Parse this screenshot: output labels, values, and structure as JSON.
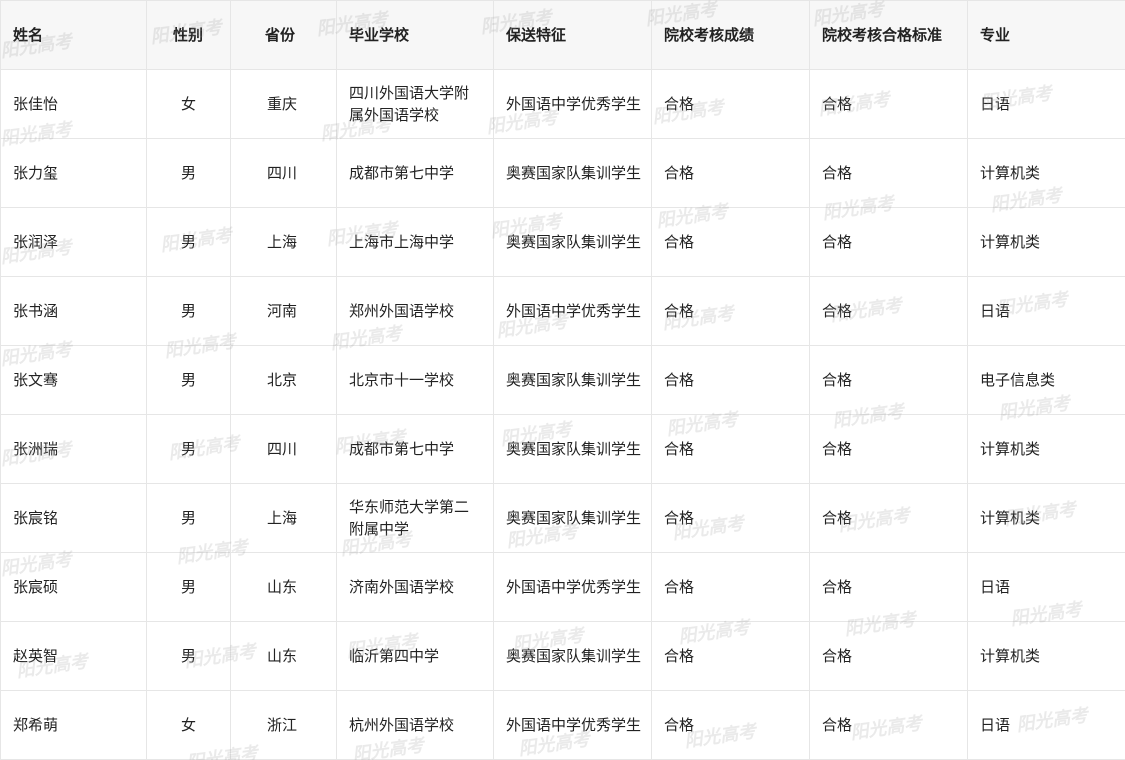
{
  "table": {
    "headers": [
      "姓名",
      "性别",
      "省份",
      "毕业学校",
      "保送特征",
      "院校考核成绩",
      "院校考核合格标准",
      "专业"
    ],
    "rows": [
      [
        "张佳怡",
        "女",
        "重庆",
        "四川外国语大学附属外国语学校",
        "外国语中学优秀学生",
        "合格",
        "合格",
        "日语"
      ],
      [
        "张力玺",
        "男",
        "四川",
        "成都市第七中学",
        "奥赛国家队集训学生",
        "合格",
        "合格",
        "计算机类"
      ],
      [
        "张润泽",
        "男",
        "上海",
        "上海市上海中学",
        "奥赛国家队集训学生",
        "合格",
        "合格",
        "计算机类"
      ],
      [
        "张书涵",
        "男",
        "河南",
        "郑州外国语学校",
        "外国语中学优秀学生",
        "合格",
        "合格",
        "日语"
      ],
      [
        "张文骞",
        "男",
        "北京",
        "北京市十一学校",
        "奥赛国家队集训学生",
        "合格",
        "合格",
        "电子信息类"
      ],
      [
        "张洲瑞",
        "男",
        "四川",
        "成都市第七中学",
        "奥赛国家队集训学生",
        "合格",
        "合格",
        "计算机类"
      ],
      [
        "张宸铭",
        "男",
        "上海",
        "华东师范大学第二附属中学",
        "奥赛国家队集训学生",
        "合格",
        "合格",
        "计算机类"
      ],
      [
        "张宸硕",
        "男",
        "山东",
        "济南外国语学校",
        "外国语中学优秀学生",
        "合格",
        "合格",
        "日语"
      ],
      [
        "赵英智",
        "男",
        "山东",
        "临沂第四中学",
        "奥赛国家队集训学生",
        "合格",
        "合格",
        "计算机类"
      ],
      [
        "郑希萌",
        "女",
        "浙江",
        "杭州外国语学校",
        "外国语中学优秀学生",
        "合格",
        "合格",
        "日语"
      ]
    ]
  },
  "watermark": {
    "text": "阳光高考"
  },
  "colors": {
    "header_bg": "#f7f7f7",
    "border": "#e6e6e6",
    "text": "#222222"
  }
}
